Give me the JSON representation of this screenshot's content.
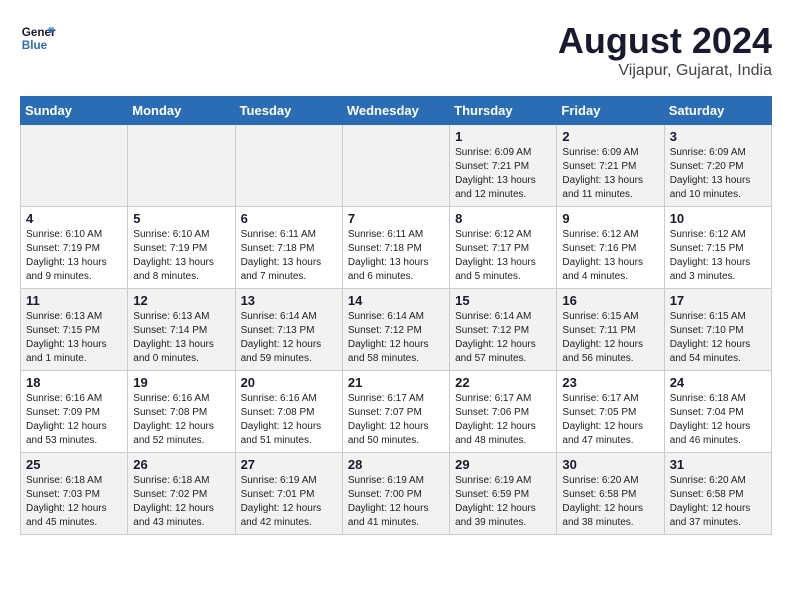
{
  "header": {
    "logo_line1": "General",
    "logo_line2": "Blue",
    "month_title": "August 2024",
    "subtitle": "Vijapur, Gujarat, India"
  },
  "days_of_week": [
    "Sunday",
    "Monday",
    "Tuesday",
    "Wednesday",
    "Thursday",
    "Friday",
    "Saturday"
  ],
  "weeks": [
    [
      {
        "day": "",
        "info": ""
      },
      {
        "day": "",
        "info": ""
      },
      {
        "day": "",
        "info": ""
      },
      {
        "day": "",
        "info": ""
      },
      {
        "day": "1",
        "info": "Sunrise: 6:09 AM\nSunset: 7:21 PM\nDaylight: 13 hours\nand 12 minutes."
      },
      {
        "day": "2",
        "info": "Sunrise: 6:09 AM\nSunset: 7:21 PM\nDaylight: 13 hours\nand 11 minutes."
      },
      {
        "day": "3",
        "info": "Sunrise: 6:09 AM\nSunset: 7:20 PM\nDaylight: 13 hours\nand 10 minutes."
      }
    ],
    [
      {
        "day": "4",
        "info": "Sunrise: 6:10 AM\nSunset: 7:19 PM\nDaylight: 13 hours\nand 9 minutes."
      },
      {
        "day": "5",
        "info": "Sunrise: 6:10 AM\nSunset: 7:19 PM\nDaylight: 13 hours\nand 8 minutes."
      },
      {
        "day": "6",
        "info": "Sunrise: 6:11 AM\nSunset: 7:18 PM\nDaylight: 13 hours\nand 7 minutes."
      },
      {
        "day": "7",
        "info": "Sunrise: 6:11 AM\nSunset: 7:18 PM\nDaylight: 13 hours\nand 6 minutes."
      },
      {
        "day": "8",
        "info": "Sunrise: 6:12 AM\nSunset: 7:17 PM\nDaylight: 13 hours\nand 5 minutes."
      },
      {
        "day": "9",
        "info": "Sunrise: 6:12 AM\nSunset: 7:16 PM\nDaylight: 13 hours\nand 4 minutes."
      },
      {
        "day": "10",
        "info": "Sunrise: 6:12 AM\nSunset: 7:15 PM\nDaylight: 13 hours\nand 3 minutes."
      }
    ],
    [
      {
        "day": "11",
        "info": "Sunrise: 6:13 AM\nSunset: 7:15 PM\nDaylight: 13 hours\nand 1 minute."
      },
      {
        "day": "12",
        "info": "Sunrise: 6:13 AM\nSunset: 7:14 PM\nDaylight: 13 hours\nand 0 minutes."
      },
      {
        "day": "13",
        "info": "Sunrise: 6:14 AM\nSunset: 7:13 PM\nDaylight: 12 hours\nand 59 minutes."
      },
      {
        "day": "14",
        "info": "Sunrise: 6:14 AM\nSunset: 7:12 PM\nDaylight: 12 hours\nand 58 minutes."
      },
      {
        "day": "15",
        "info": "Sunrise: 6:14 AM\nSunset: 7:12 PM\nDaylight: 12 hours\nand 57 minutes."
      },
      {
        "day": "16",
        "info": "Sunrise: 6:15 AM\nSunset: 7:11 PM\nDaylight: 12 hours\nand 56 minutes."
      },
      {
        "day": "17",
        "info": "Sunrise: 6:15 AM\nSunset: 7:10 PM\nDaylight: 12 hours\nand 54 minutes."
      }
    ],
    [
      {
        "day": "18",
        "info": "Sunrise: 6:16 AM\nSunset: 7:09 PM\nDaylight: 12 hours\nand 53 minutes."
      },
      {
        "day": "19",
        "info": "Sunrise: 6:16 AM\nSunset: 7:08 PM\nDaylight: 12 hours\nand 52 minutes."
      },
      {
        "day": "20",
        "info": "Sunrise: 6:16 AM\nSunset: 7:08 PM\nDaylight: 12 hours\nand 51 minutes."
      },
      {
        "day": "21",
        "info": "Sunrise: 6:17 AM\nSunset: 7:07 PM\nDaylight: 12 hours\nand 50 minutes."
      },
      {
        "day": "22",
        "info": "Sunrise: 6:17 AM\nSunset: 7:06 PM\nDaylight: 12 hours\nand 48 minutes."
      },
      {
        "day": "23",
        "info": "Sunrise: 6:17 AM\nSunset: 7:05 PM\nDaylight: 12 hours\nand 47 minutes."
      },
      {
        "day": "24",
        "info": "Sunrise: 6:18 AM\nSunset: 7:04 PM\nDaylight: 12 hours\nand 46 minutes."
      }
    ],
    [
      {
        "day": "25",
        "info": "Sunrise: 6:18 AM\nSunset: 7:03 PM\nDaylight: 12 hours\nand 45 minutes."
      },
      {
        "day": "26",
        "info": "Sunrise: 6:18 AM\nSunset: 7:02 PM\nDaylight: 12 hours\nand 43 minutes."
      },
      {
        "day": "27",
        "info": "Sunrise: 6:19 AM\nSunset: 7:01 PM\nDaylight: 12 hours\nand 42 minutes."
      },
      {
        "day": "28",
        "info": "Sunrise: 6:19 AM\nSunset: 7:00 PM\nDaylight: 12 hours\nand 41 minutes."
      },
      {
        "day": "29",
        "info": "Sunrise: 6:19 AM\nSunset: 6:59 PM\nDaylight: 12 hours\nand 39 minutes."
      },
      {
        "day": "30",
        "info": "Sunrise: 6:20 AM\nSunset: 6:58 PM\nDaylight: 12 hours\nand 38 minutes."
      },
      {
        "day": "31",
        "info": "Sunrise: 6:20 AM\nSunset: 6:58 PM\nDaylight: 12 hours\nand 37 minutes."
      }
    ]
  ]
}
